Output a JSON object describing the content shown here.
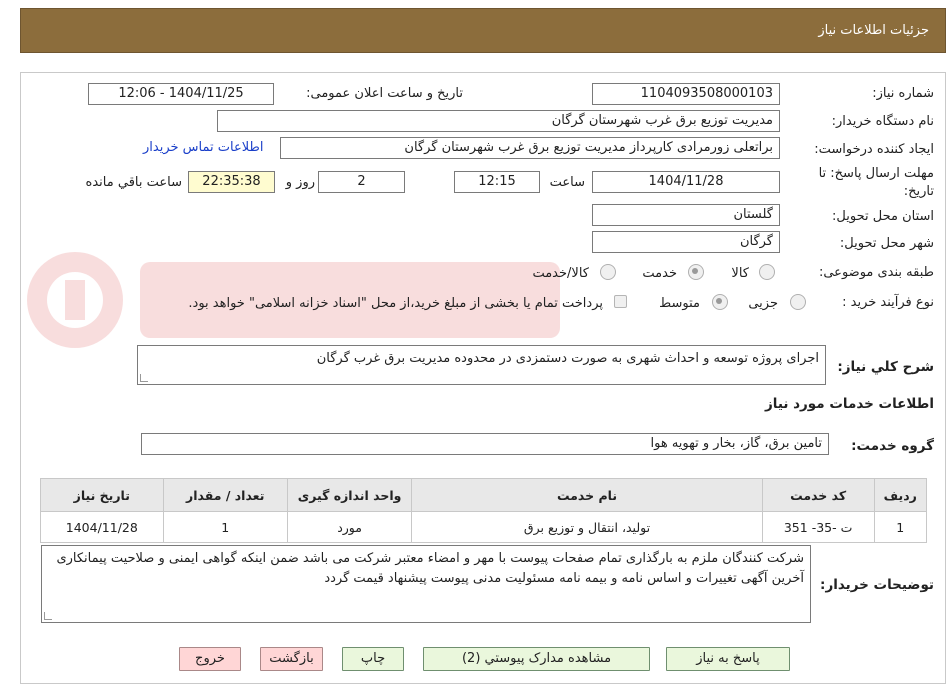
{
  "header": {
    "title": "جزئیات اطلاعات نیاز"
  },
  "labels": {
    "need_number": "شماره نیاز:",
    "announce_datetime": "تاریخ و ساعت اعلان عمومی:",
    "buyer_org": "نام دستگاه خریدار:",
    "requester": "ایجاد کننده درخواست:",
    "contact_link": "اطلاعات تماس خریدار",
    "deadline": "مهلت ارسال پاسخ: تا",
    "deadline_cont": "تاریخ:",
    "hour": "ساعت",
    "day_and": "روز و",
    "hours_left": "ساعت باقي مانده",
    "province": "استان محل تحویل:",
    "city": "شهر محل تحویل:",
    "category": "طبقه بندی موضوعی:",
    "process": "نوع فرآیند خرید :",
    "general_desc": "شرح كلي نياز:",
    "services_info": "اطلاعات خدمات مورد نیاز",
    "service_group": "گروه خدمت:",
    "buyer_notes": "توضیحات خریدار:"
  },
  "values": {
    "need_number": "1104093508000103",
    "announce_datetime": "1404/11/25 - 12:06",
    "buyer_org": "مدیریت توزیع برق غرب شهرستان گرگان",
    "requester": "براتعلی زورمرادی کارپرداز مدیریت توزیع برق غرب شهرستان گرگان",
    "deadline_date": "1404/11/28",
    "deadline_time": "12:15",
    "days": "2",
    "time_left": "22:35:38",
    "province": "گلستان",
    "city": "گرگان",
    "general_desc": "اجرای پروژه توسعه و احداث شهری به صورت دستمزدی در محدوده مدیریت برق غرب گرگان",
    "service_group": "تامین برق، گاز، بخار و تهویه هوا",
    "buyer_notes": "شرکت کنندگان ملزم به بارگذاری تمام صفحات پیوست با مهر و امضاء معتبر شرکت می باشد ضمن اینکه گواهی ایمنی و صلاحیت پیمانکاری آخرین آگهی تغییرات و اساس نامه و بیمه نامه مسئولیت مدنی پیوست پیشنهاد قیمت گردد"
  },
  "category_options": [
    {
      "label": "کالا",
      "checked": false
    },
    {
      "label": "خدمت",
      "checked": true
    },
    {
      "label": "کالا/خدمت",
      "checked": false
    }
  ],
  "process_options": [
    {
      "label": "جزیی",
      "checked": false
    },
    {
      "label": "متوسط",
      "checked": true
    }
  ],
  "payment_note": "پرداخت تمام یا بخشی از مبلغ خرید،از محل \"اسناد خزانه اسلامی\" خواهد بود.",
  "table": {
    "headers": [
      "ردیف",
      "کد خدمت",
      "نام خدمت",
      "واحد اندازه گیری",
      "تعداد / مقدار",
      "تاریخ نیاز"
    ],
    "rows": [
      [
        "1",
        "ت -35- 351",
        "تولید، انتقال و توزیع برق",
        "مورد",
        "1",
        "1404/11/28"
      ]
    ]
  },
  "buttons": {
    "reply": "پاسخ به نیاز",
    "attachments": "مشاهده مدارک پیوستي (2)",
    "print": "چاپ",
    "back": "بازگشت",
    "exit": "خروج"
  },
  "colors": {
    "header_bg": "#8c6d3c",
    "button_bg": "#eaf7dc",
    "exit_bg": "#ffd6d6",
    "time_left_bg": "#fffcd0",
    "link": "#1a3fc9"
  }
}
